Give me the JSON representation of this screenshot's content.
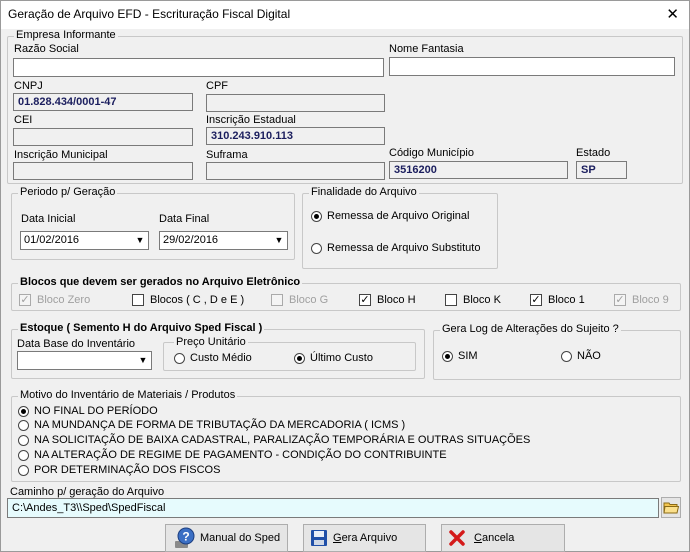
{
  "window": {
    "title": "Geração de Arquivo EFD - Escrituração Fiscal Digital",
    "close_glyph": "✕"
  },
  "empresa": {
    "legend": "Empresa Informante",
    "razao_social_label": "Razão Social",
    "razao_social": "",
    "nome_fantasia_label": "Nome Fantasia",
    "nome_fantasia": "",
    "cnpj_label": "CNPJ",
    "cnpj": "01.828.434/0001-47",
    "cpf_label": "CPF",
    "cpf": "",
    "cei_label": "CEI",
    "cei": "",
    "ie_label": "Inscrição Estadual",
    "ie": "310.243.910.113",
    "im_label": "Inscrição Municipal",
    "im": "",
    "suframa_label": "Suframa",
    "suframa": "",
    "cod_municipio_label": "Código Município",
    "cod_municipio": "3516200",
    "estado_label": "Estado",
    "estado": "SP"
  },
  "periodo": {
    "legend": "Periodo p/ Geração",
    "inicial_label": "Data Inicial",
    "inicial": "01/02/2016",
    "final_label": "Data Final",
    "final": "29/02/2016"
  },
  "finalidade": {
    "legend": "Finalidade do Arquivo",
    "options": [
      "Remessa de Arquivo Original",
      "Remessa de Arquivo Substituto"
    ],
    "selected": 0
  },
  "blocos": {
    "legend": "Blocos que devem ser gerados no Arquivo Eletrônico",
    "items": [
      {
        "label": "Bloco Zero",
        "checked": true,
        "enabled": false
      },
      {
        "label": "Blocos ( C , D e E )",
        "checked": false,
        "enabled": true
      },
      {
        "label": "Bloco G",
        "checked": false,
        "enabled": false
      },
      {
        "label": "Bloco H",
        "checked": true,
        "enabled": true
      },
      {
        "label": "Bloco K",
        "checked": false,
        "enabled": true
      },
      {
        "label": "Bloco 1",
        "checked": true,
        "enabled": true
      },
      {
        "label": "Bloco 9",
        "checked": true,
        "enabled": false
      }
    ]
  },
  "estoque": {
    "legend": "Estoque ( Semento H do Arquivo Sped Fiscal )",
    "data_base_label": "Data Base do Inventário",
    "data_base": "",
    "preco_legend": "Preço Unitário",
    "preco_options": [
      "Custo Médio",
      "Último Custo"
    ],
    "preco_selected": 1
  },
  "log": {
    "legend": "Gera Log de Alterações do Sujeito ?",
    "options": [
      "SIM",
      "NÃO"
    ],
    "selected": 0
  },
  "motivo": {
    "legend": "Motivo do Inventário de Materiais / Produtos",
    "options": [
      "NO FINAL DO PERÍODO",
      "NA MUNDANÇA DE FORMA DE TRIBUTAÇÃO DA MERCADORIA ( ICMS )",
      "NA SOLICITAÇÃO DE BAIXA CADASTRAL, PARALIZAÇÃO TEMPORÁRIA E OUTRAS SITUAÇÕES",
      "NA ALTERAÇÃO DE REGIME DE PAGAMENTO - CONDIÇÃO DO CONTRIBUINTE",
      "POR DETERMINAÇÃO DOS FISCOS"
    ],
    "selected": 0
  },
  "caminho": {
    "label": "Caminho p/ geração do Arquivo",
    "value": "C:\\Andes_T3\\\\Sped\\SpedFiscal"
  },
  "buttons": {
    "manual": "Manual do Sped",
    "gera_first": "G",
    "gera_rest": "era Arquivo",
    "cancela_first": "C",
    "cancela_rest": "ancela"
  },
  "icons": {
    "help": "help-icon",
    "save": "floppy-disk-icon",
    "cancel": "red-x-icon",
    "folder": "folder-icon"
  },
  "colors": {
    "field_text": "#1b1e5e",
    "path_bg": "#e6fbfd",
    "cancel_red": "#d41a1a",
    "save_blue": "#1f4fa8"
  }
}
